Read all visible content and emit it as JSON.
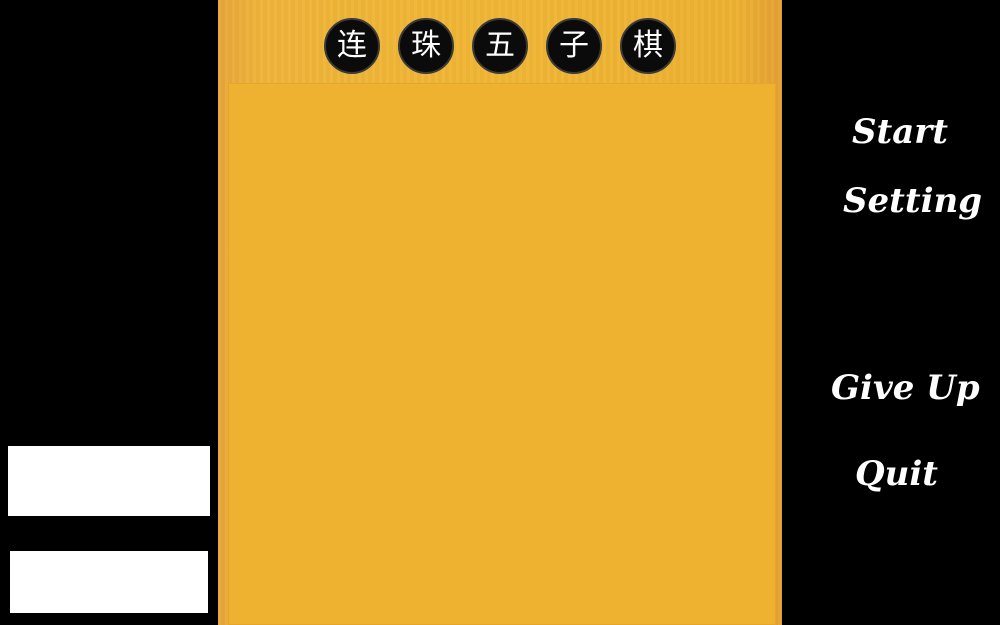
{
  "title": {
    "chars": [
      "连",
      "珠",
      "五",
      "子",
      "棋"
    ]
  },
  "menu": {
    "start_label": "Start",
    "setting_label": "Setting",
    "give_up_label": "Give Up",
    "quit_label": "Quit"
  },
  "colors": {
    "background": "#000000",
    "board": "#efb230",
    "title_circle": "#0b0b0b",
    "menu_text": "#ffffff"
  }
}
